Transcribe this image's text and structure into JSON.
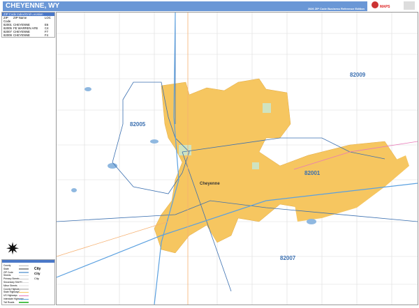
{
  "header": {
    "title": "CHEYENNE, WY",
    "edition": "2026 ZIP Code Business Reference Edition"
  },
  "logo": {
    "brand": "MAPS"
  },
  "zip_index": {
    "title": "ZIP Code Index/Grid Location",
    "columns": [
      "ZIP Code",
      "ZIP Name",
      "LOC"
    ],
    "rows": [
      [
        "82001",
        "CHEYENNE",
        "E6"
      ],
      [
        "82005",
        "FE WARREN AFB",
        "C4"
      ],
      [
        "82007",
        "CHEYENNE",
        "F7"
      ],
      [
        "82009",
        "CHEYENNE",
        "F4"
      ]
    ]
  },
  "map": {
    "city_label": "Cheyenne",
    "zip_labels": [
      "82009",
      "82005",
      "82001",
      "82007"
    ],
    "colors": {
      "city": "#f6c660",
      "zip_boundary": "#3a6fb0",
      "water": "#8fb8e0",
      "header": "#6a97d6"
    }
  },
  "legend": {
    "items": [
      "County",
      "State",
      "ZIP Code",
      "Streets",
      "Primary Streets",
      "Secondary Streets",
      "Minor Streets",
      "County Highways",
      "State Highways",
      "US Highways",
      "Interstate Highways",
      "Toll Roads"
    ],
    "city_samples": [
      "City",
      "City",
      "City"
    ],
    "swatch_colors": [
      "#bbb",
      "#999",
      "#8fb8e0",
      "#ddd",
      "#ccc",
      "#ddd",
      "#eee",
      "#ccc",
      "#f6c660",
      "#e878b8",
      "#5aa0e0",
      "#50c050"
    ]
  },
  "compass": {
    "icon": "compass-rose-icon"
  }
}
